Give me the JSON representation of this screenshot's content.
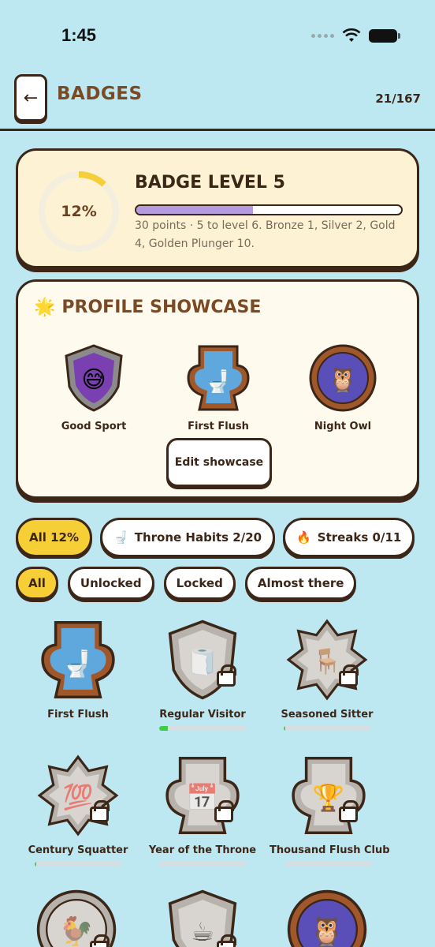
{
  "status": {
    "time": "1:45"
  },
  "header": {
    "back_label": "←",
    "title": "BADGES",
    "count": "21/167"
  },
  "level": {
    "percent_label": "12%",
    "percent": 0.12,
    "title": "BADGE LEVEL 5",
    "progress": 0.44,
    "description": "30 points · 5 to level 6. Bronze 1, Silver 2, Gold 4, Golden Plunger 10."
  },
  "showcase": {
    "title": "PROFILE SHOWCASE",
    "star_emoji": "🌟",
    "items": [
      {
        "label": "Good Sport",
        "emoji": "😅"
      },
      {
        "label": "First Flush",
        "emoji": "🚽"
      },
      {
        "label": "Night Owl",
        "emoji": "🦉"
      }
    ],
    "edit_label": "Edit showcase"
  },
  "categories": [
    {
      "emoji": "",
      "label": "All 12%",
      "active": true
    },
    {
      "emoji": "🚽",
      "label": "Throne Habits 2/20",
      "active": false
    },
    {
      "emoji": "🔥",
      "label": "Streaks 0/11",
      "active": false
    },
    {
      "emoji": "",
      "label": "",
      "active": false
    }
  ],
  "filters": [
    {
      "label": "All",
      "active": true
    },
    {
      "label": "Unlocked",
      "active": false
    },
    {
      "label": "Locked",
      "active": false
    },
    {
      "label": "Almost there",
      "active": false
    }
  ],
  "badges": [
    {
      "name": "First Flush",
      "emoji": "🚽",
      "locked": false,
      "progress": null
    },
    {
      "name": "Regular Visitor",
      "emoji": "🧻",
      "locked": true,
      "progress": 0.1
    },
    {
      "name": "Seasoned Sitter",
      "emoji": "🪑",
      "locked": true,
      "progress": 0.02
    },
    {
      "name": "Century Squatter",
      "emoji": "💯",
      "locked": true,
      "progress": 0.02
    },
    {
      "name": "Year of the Throne",
      "emoji": "📅",
      "locked": true,
      "progress": 0
    },
    {
      "name": "Thousand Flush Club",
      "emoji": "🏆",
      "locked": true,
      "progress": 0
    },
    {
      "name": "",
      "emoji": "🐓",
      "locked": true,
      "progress": null
    },
    {
      "name": "",
      "emoji": "☕",
      "locked": true,
      "progress": null
    },
    {
      "name": "",
      "emoji": "🦉",
      "locked": false,
      "progress": null
    }
  ],
  "colors": {
    "background": "#bde8f2",
    "ink": "#3b2618",
    "accent_yellow": "#f6cf36",
    "progress_purple": "#b49be0",
    "progress_green": "#3fcc4b"
  }
}
